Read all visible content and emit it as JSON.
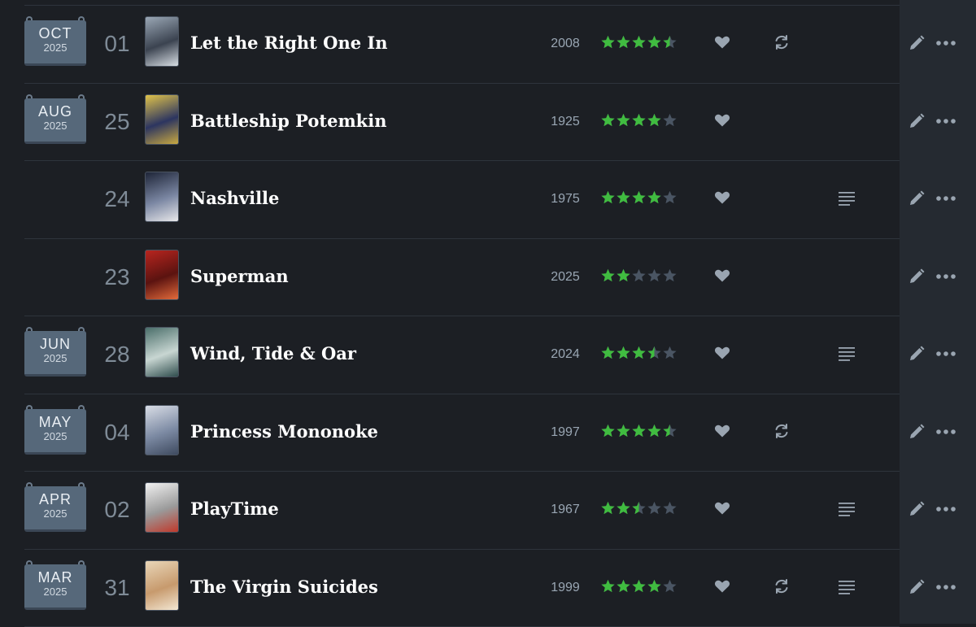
{
  "diary": [
    {
      "month": "OCT",
      "year": "2025",
      "day": "01",
      "title": "Let the Right One In",
      "release_year": "2008",
      "rating": 4.5,
      "liked": true,
      "rewatch": true,
      "review": false,
      "poster_colors": [
        "#9aa7b5",
        "#3b4350",
        "#d7dde3"
      ]
    },
    {
      "month": "AUG",
      "year": "2025",
      "day": "25",
      "title": "Battleship Potemkin",
      "release_year": "1925",
      "rating": 4,
      "liked": true,
      "rewatch": false,
      "review": false,
      "poster_colors": [
        "#e0c34a",
        "#2c3560",
        "#c9a941"
      ]
    },
    {
      "month": "",
      "year": "",
      "day": "24",
      "title": "Nashville",
      "release_year": "1975",
      "rating": 4,
      "liked": true,
      "rewatch": false,
      "review": true,
      "poster_colors": [
        "#1e2538",
        "#7b87a3",
        "#e8e8ea"
      ]
    },
    {
      "month": "",
      "year": "",
      "day": "23",
      "title": "Superman",
      "release_year": "2025",
      "rating": 2,
      "liked": true,
      "rewatch": false,
      "review": false,
      "poster_colors": [
        "#b8251f",
        "#5b1310",
        "#e36b3b"
      ]
    },
    {
      "month": "JUN",
      "year": "2025",
      "day": "28",
      "title": "Wind, Tide & Oar",
      "release_year": "2024",
      "rating": 3.5,
      "liked": true,
      "rewatch": false,
      "review": true,
      "poster_colors": [
        "#4a6e6a",
        "#c8d6d2",
        "#2f4d4d"
      ]
    },
    {
      "month": "MAY",
      "year": "2025",
      "day": "04",
      "title": "Princess Mononoke",
      "release_year": "1997",
      "rating": 4.5,
      "liked": true,
      "rewatch": true,
      "review": false,
      "poster_colors": [
        "#d9dde6",
        "#7c8aa3",
        "#3e4a5f"
      ]
    },
    {
      "month": "APR",
      "year": "2025",
      "day": "02",
      "title": "PlayTime",
      "release_year": "1967",
      "rating": 2.5,
      "liked": true,
      "rewatch": false,
      "review": true,
      "poster_colors": [
        "#f1f1f1",
        "#9a9a9a",
        "#c0392b"
      ]
    },
    {
      "month": "MAR",
      "year": "2025",
      "day": "31",
      "title": "The Virgin Suicides",
      "release_year": "1999",
      "rating": 4,
      "liked": true,
      "rewatch": true,
      "review": true,
      "poster_colors": [
        "#e9d6b8",
        "#c79a6d",
        "#f3e7d3"
      ]
    }
  ],
  "colors": {
    "star_on": "#40bc40",
    "star_off": "#4a5563",
    "icon": "#9aa5b1",
    "background": "#1c1f24"
  },
  "icons": {
    "like": "heart-icon",
    "rewatch": "rewatch-icon",
    "review": "review-lines-icon",
    "edit": "pencil-icon",
    "more": "more-dots-icon"
  }
}
